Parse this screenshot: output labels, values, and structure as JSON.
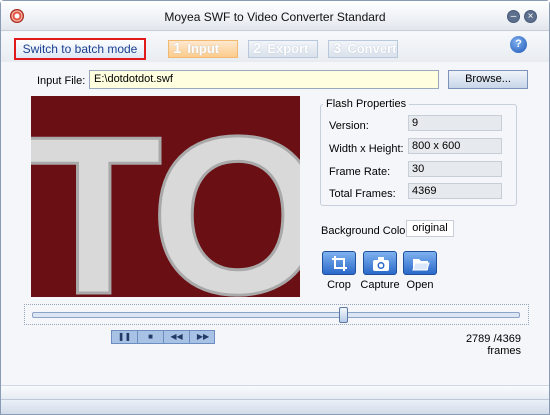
{
  "window": {
    "title": "Moyea SWF to Video Converter Standard",
    "minimize_icon": "minimize-icon",
    "close_icon": "close-icon"
  },
  "toolbar": {
    "batch_label": "Switch to batch mode",
    "steps": [
      {
        "num": "1",
        "label": "Input",
        "active": true
      },
      {
        "num": "2",
        "label": "Export",
        "active": false
      },
      {
        "num": "3",
        "label": "Convert",
        "active": false
      }
    ],
    "help_label": "?"
  },
  "input": {
    "label": "Input File:",
    "value": "E:\\dotdotdot.swf",
    "browse_label": "Browse..."
  },
  "preview": {
    "text": "TO"
  },
  "flash_properties": {
    "title": "Flash Properties",
    "rows": [
      {
        "label": "Version:",
        "value": "9"
      },
      {
        "label": "Width x Height:",
        "value": "800 x 600"
      },
      {
        "label": "Frame Rate:",
        "value": "30"
      },
      {
        "label": "Total Frames:",
        "value": "4369"
      }
    ]
  },
  "background": {
    "label": "Background Color:",
    "value": "original"
  },
  "tools": [
    {
      "label": "Crop",
      "icon": "crop-icon"
    },
    {
      "label": "Capture",
      "icon": "camera-icon"
    },
    {
      "label": "Open",
      "icon": "folder-icon"
    }
  ],
  "playback": {
    "progress": 0.638,
    "frames_text": "2789 /4369 frames",
    "buttons": [
      {
        "name": "pause",
        "glyph": "❚❚"
      },
      {
        "name": "stop",
        "glyph": "■"
      },
      {
        "name": "rewind",
        "glyph": "◀◀"
      },
      {
        "name": "forward",
        "glyph": "▶▶"
      }
    ]
  },
  "colors": {
    "accent": "#2a69c9",
    "batch_border": "#e01a1a",
    "preview_bg": "#6a0f14"
  }
}
